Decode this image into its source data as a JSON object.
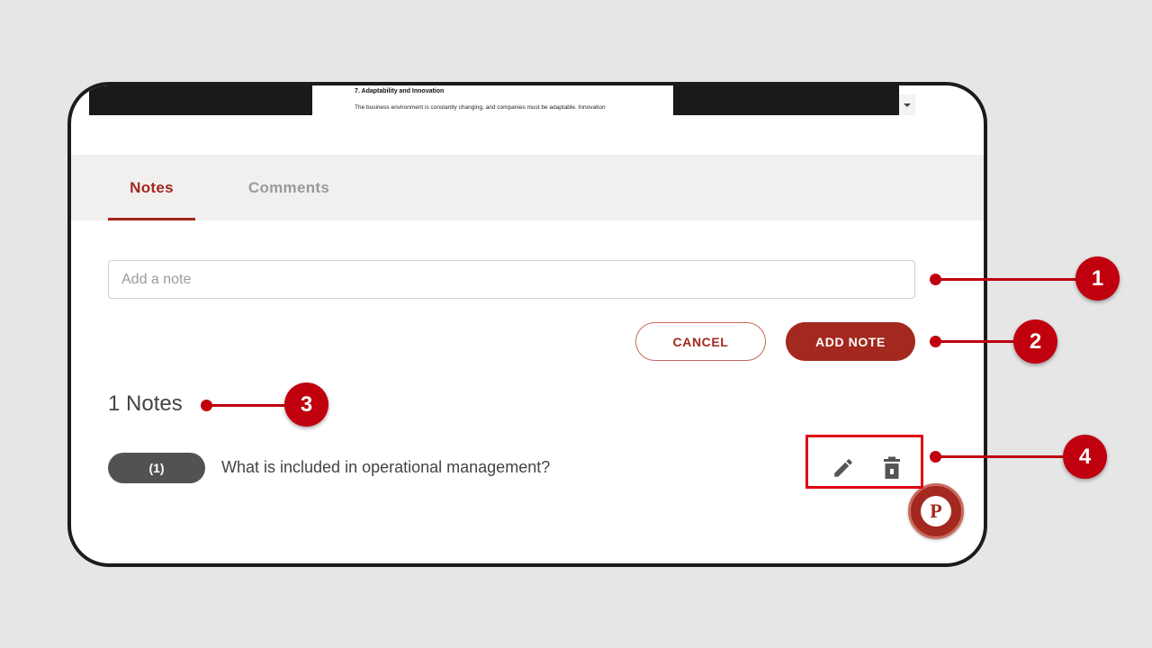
{
  "document_preview": {
    "heading": "7. Adaptability and Innovation",
    "body": "The business environment is constantly changing, and companies must be adaptable. Innovation"
  },
  "tabs": [
    {
      "label": "Notes",
      "active": true
    },
    {
      "label": "Comments",
      "active": false
    }
  ],
  "note_input": {
    "placeholder": "Add a note",
    "value": ""
  },
  "buttons": {
    "cancel_label": "CANCEL",
    "add_label": "ADD NOTE"
  },
  "notes_count_label": "1 Notes",
  "notes": [
    {
      "badge": "(1)",
      "text": "What is included in operational management?"
    }
  ],
  "callouts": [
    "1",
    "2",
    "3",
    "4"
  ],
  "icons": {
    "edit": "pencil-icon",
    "delete": "trash-icon",
    "fab": "p-logo-icon"
  },
  "colors": {
    "accent": "#a3281f",
    "callout": "#c0000e",
    "pill": "#525252"
  }
}
